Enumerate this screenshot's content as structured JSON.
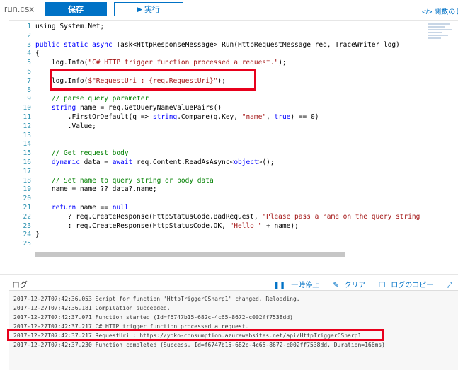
{
  "header": {
    "filename": "run.csx",
    "save_label": "保存",
    "run_label": "実行",
    "function_list_label": "</> 関数のし"
  },
  "editor": {
    "lines": [
      {
        "n": "1",
        "segs": [
          {
            "t": "using System.Net;",
            "c": ""
          }
        ]
      },
      {
        "n": "2",
        "segs": []
      },
      {
        "n": "3",
        "segs": [
          {
            "t": "public static async ",
            "c": "kw"
          },
          {
            "t": "Task<HttpResponseMessage> Run(HttpRequestMessage req, TraceWriter log)",
            "c": ""
          }
        ]
      },
      {
        "n": "4",
        "segs": [
          {
            "t": "{",
            "c": ""
          }
        ]
      },
      {
        "n": "5",
        "segs": [
          {
            "t": "    log.Info(",
            "c": ""
          },
          {
            "t": "\"C# HTTP trigger function processed a request.\"",
            "c": "str"
          },
          {
            "t": ");",
            "c": ""
          }
        ]
      },
      {
        "n": "6",
        "segs": []
      },
      {
        "n": "7",
        "segs": [
          {
            "t": "    log.Info(",
            "c": ""
          },
          {
            "t": "$\"RequestUri : {req.RequestUri}\"",
            "c": "str"
          },
          {
            "t": ");",
            "c": ""
          }
        ]
      },
      {
        "n": "8",
        "segs": []
      },
      {
        "n": "9",
        "segs": [
          {
            "t": "    // parse query parameter",
            "c": "cm"
          }
        ]
      },
      {
        "n": "10",
        "segs": [
          {
            "t": "    ",
            "c": ""
          },
          {
            "t": "string",
            "c": "kw"
          },
          {
            "t": " name = req.GetQueryNameValuePairs()",
            "c": ""
          }
        ]
      },
      {
        "n": "11",
        "segs": [
          {
            "t": "        .FirstOrDefault(q => ",
            "c": ""
          },
          {
            "t": "string",
            "c": "kw"
          },
          {
            "t": ".Compare(q.Key, ",
            "c": ""
          },
          {
            "t": "\"name\"",
            "c": "str"
          },
          {
            "t": ", ",
            "c": ""
          },
          {
            "t": "true",
            "c": "kw"
          },
          {
            "t": ") == 0)",
            "c": ""
          }
        ]
      },
      {
        "n": "12",
        "segs": [
          {
            "t": "        .Value;",
            "c": ""
          }
        ]
      },
      {
        "n": "13",
        "segs": []
      },
      {
        "n": "14",
        "segs": []
      },
      {
        "n": "15",
        "segs": [
          {
            "t": "    // Get request body",
            "c": "cm"
          }
        ]
      },
      {
        "n": "16",
        "segs": [
          {
            "t": "    ",
            "c": ""
          },
          {
            "t": "dynamic",
            "c": "kw"
          },
          {
            "t": " data = ",
            "c": ""
          },
          {
            "t": "await",
            "c": "kw"
          },
          {
            "t": " req.Content.ReadAsAsync<",
            "c": ""
          },
          {
            "t": "object",
            "c": "kw"
          },
          {
            "t": ">();",
            "c": ""
          }
        ]
      },
      {
        "n": "17",
        "segs": []
      },
      {
        "n": "18",
        "segs": [
          {
            "t": "    // Set name to query string or body data",
            "c": "cm"
          }
        ]
      },
      {
        "n": "19",
        "segs": [
          {
            "t": "    name = name ?? data?.name;",
            "c": ""
          }
        ]
      },
      {
        "n": "20",
        "segs": []
      },
      {
        "n": "21",
        "segs": [
          {
            "t": "    ",
            "c": ""
          },
          {
            "t": "return",
            "c": "kw"
          },
          {
            "t": " name == ",
            "c": ""
          },
          {
            "t": "null",
            "c": "kw"
          }
        ]
      },
      {
        "n": "22",
        "segs": [
          {
            "t": "        ? req.CreateResponse(HttpStatusCode.BadRequest, ",
            "c": ""
          },
          {
            "t": "\"Please pass a name on the query string",
            "c": "str"
          }
        ]
      },
      {
        "n": "23",
        "segs": [
          {
            "t": "        : req.CreateResponse(HttpStatusCode.OK, ",
            "c": ""
          },
          {
            "t": "\"Hello \"",
            "c": "str"
          },
          {
            "t": " + name);",
            "c": ""
          }
        ]
      },
      {
        "n": "24",
        "segs": [
          {
            "t": "}",
            "c": ""
          }
        ]
      },
      {
        "n": "25",
        "segs": []
      }
    ]
  },
  "log": {
    "title": "ログ",
    "pause_label": "一時停止",
    "clear_label": "クリア",
    "copy_label": "ログのコピー",
    "expand_label": "",
    "lines": [
      "2017-12-27T07:42:36.053 Script for function 'HttpTriggerCSharp1' changed. Reloading.",
      "2017-12-27T07:42:36.181 Compilation succeeded.",
      "2017-12-27T07:42:37.071 Function started (Id=f6747b15-682c-4c65-8672-c002ff7538dd)",
      "2017-12-27T07:42:37.217 C# HTTP trigger function processed a request.",
      "2017-12-27T07:42:37.217 RequestUri : https://yoko-consumption.azurewebsites.net/api/HttpTriggerCSharp1",
      "2017-12-27T07:42:37.230 Function completed (Success, Id=f6747b15-682c-4c65-8672-c002ff7538dd, Duration=166ms)"
    ]
  },
  "colors": {
    "accent": "#0072c6",
    "highlight_border": "#e8001c"
  }
}
